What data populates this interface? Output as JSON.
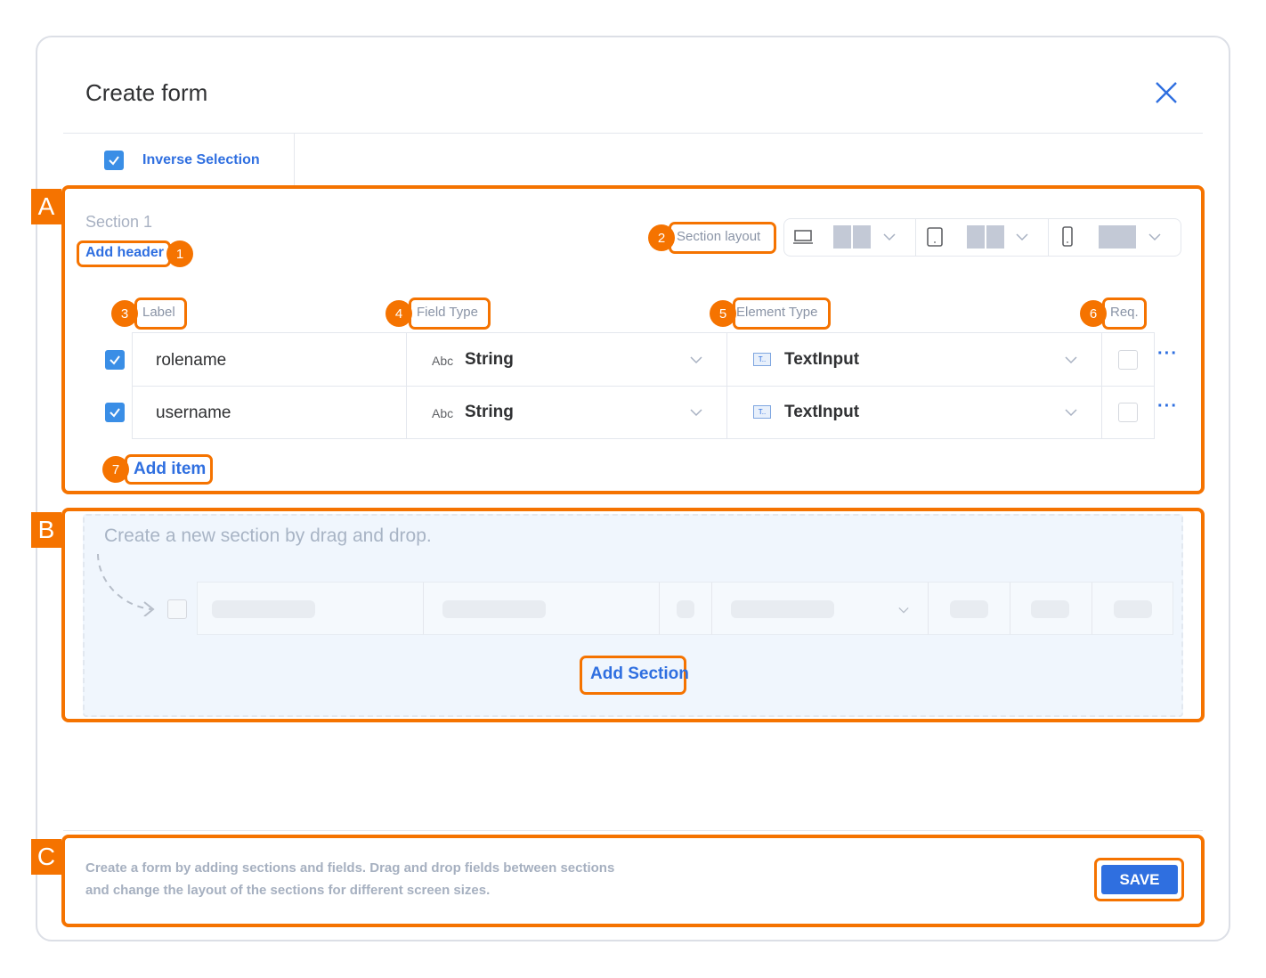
{
  "dialog": {
    "title": "Create form",
    "inverse_selection": "Inverse Selection"
  },
  "section": {
    "title": "Section 1",
    "add_header": "Add header",
    "layout_label": "Section layout",
    "columns": {
      "label": "Label",
      "field_type": "Field Type",
      "element_type": "Element Type",
      "req": "Req."
    },
    "rows": [
      {
        "label": "rolename",
        "type_icon": "Abc",
        "field_type": "String",
        "element_icon": "T..",
        "element_type": "TextInput",
        "checked": true,
        "required": false
      },
      {
        "label": "username",
        "type_icon": "Abc",
        "field_type": "String",
        "element_icon": "T..",
        "element_type": "TextInput",
        "checked": true,
        "required": false
      }
    ],
    "add_item": "Add item",
    "more": "···"
  },
  "new_section": {
    "hint": "Create a new section by drag and drop.",
    "add_section": "Add Section"
  },
  "footer": {
    "help_line1": "Create a form by adding sections and fields. Drag and drop fields between sections",
    "help_line2": "and change the layout of the sections for different screen sizes.",
    "save": "SAVE"
  },
  "annotations": {
    "letters": [
      "A",
      "B",
      "C"
    ],
    "numbers": [
      "1",
      "2",
      "3",
      "4",
      "5",
      "6",
      "7"
    ]
  },
  "colors": {
    "accent": "#2f6fe0",
    "checkbox": "#3a8ee6",
    "annotation": "#f57300"
  }
}
